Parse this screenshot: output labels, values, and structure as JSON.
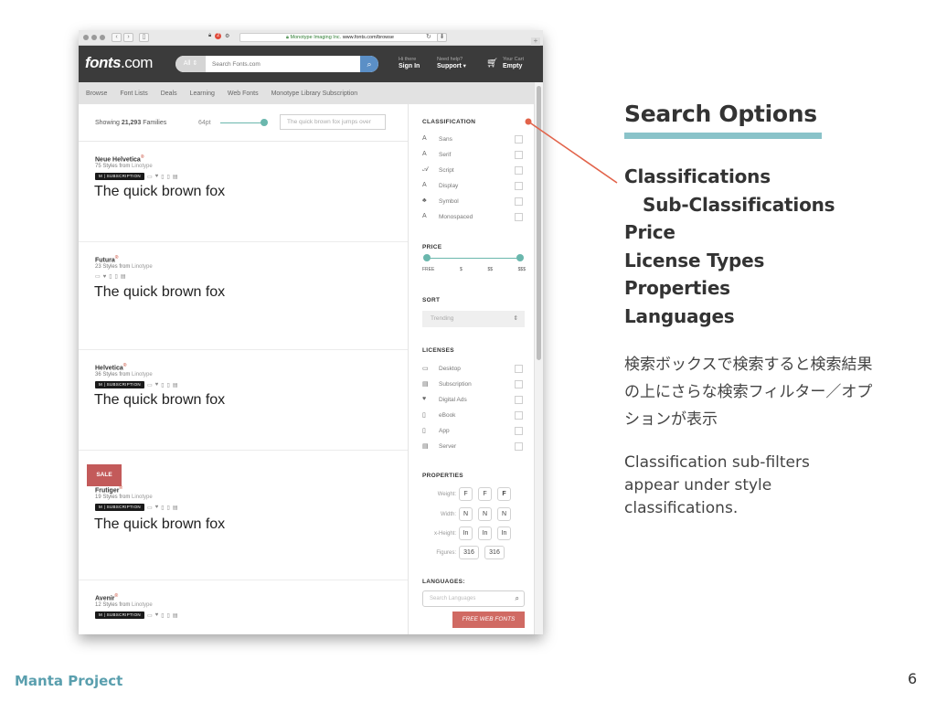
{
  "browser": {
    "url_org": "Monotype Imaging Inc.",
    "url_domain": "www.fonts.com/browse",
    "ext_badge": "2"
  },
  "site": {
    "logo_bold": "fonts",
    "logo_rest": ".com",
    "search_scope": "All",
    "search_placeholder": "Search Fonts.com",
    "hi_label": "Hi there",
    "signin": "Sign In",
    "help_label": "Need help?",
    "support": "Support",
    "cart_label": "Your Cart",
    "cart_status": "Empty"
  },
  "subnav": [
    "Browse",
    "Font Lists",
    "Deals",
    "Learning",
    "Web Fonts",
    "Monotype Library Subscription"
  ],
  "results_bar": {
    "showing_prefix": "Showing",
    "count": "21,293",
    "showing_suffix": "Families",
    "size": "64pt",
    "sample_placeholder": "The quick brown fox jumps over"
  },
  "fonts": [
    {
      "name": "Neue Helvetica",
      "styles": "75 Styles from",
      "foundry": "Linotype",
      "sample": "The quick brown fox",
      "subscription": true,
      "sale": false
    },
    {
      "name": "Futura",
      "styles": "23 Styles from",
      "foundry": "Linotype",
      "sample": "The quick brown fox",
      "subscription": false,
      "sale": false
    },
    {
      "name": "Helvetica",
      "styles": "36 Styles from",
      "foundry": "Linotype",
      "sample": "The quick brown fox",
      "subscription": true,
      "sale": false
    },
    {
      "name": "Frutiger",
      "styles": "19 Styles from",
      "foundry": "Linotype",
      "sample": "The quick brown fox",
      "subscription": true,
      "sale": true
    },
    {
      "name": "Avenir",
      "styles": "12 Styles from",
      "foundry": "Linotype",
      "sample": "The quick brown fox",
      "subscription": true,
      "sale": false
    }
  ],
  "subscription_label": "SUBSCRIPTION",
  "sale_label": "SALE",
  "filters": {
    "classification_title": "CLASSIFICATION",
    "classifications": [
      "Sans",
      "Serif",
      "Script",
      "Display",
      "Symbol",
      "Monospaced"
    ],
    "price_title": "PRICE",
    "price_labels": [
      "FREE",
      "$",
      "$$",
      "$$$"
    ],
    "sort_title": "SORT",
    "sort_value": "Trending",
    "licenses_title": "LICENSES",
    "licenses": [
      "Desktop",
      "Subscription",
      "Digital Ads",
      "eBook",
      "App",
      "Server"
    ],
    "properties_title": "PROPERTIES",
    "properties": [
      {
        "label": "Weight:",
        "options": [
          "F",
          "F",
          "F"
        ]
      },
      {
        "label": "Width:",
        "options": [
          "N",
          "N",
          "N"
        ]
      },
      {
        "label": "x-Height:",
        "options": [
          "In",
          "In",
          "In"
        ]
      },
      {
        "label": "Figures:",
        "options": [
          "316",
          "316"
        ]
      }
    ],
    "languages_title": "LANGUAGES:",
    "languages_placeholder": "Search Languages",
    "free_web_fonts": "FREE WEB FONTS"
  },
  "slide": {
    "heading": "Search Options",
    "options": [
      "Classifications",
      "Sub-Classifications",
      "Price",
      "License Types",
      "Properties",
      "Languages"
    ],
    "jp_text": "検索ボックスで検索すると検索結果の上にさらな検索フィルター／オプションが表示",
    "en_text": "Classification sub-filters appear under style classifications.",
    "footer_left": "Manta Project",
    "page_number": "6"
  },
  "colors": {
    "accent_teal": "#8ac3c9",
    "footer_blue": "#5a9fae",
    "callout_red": "#e2634a",
    "sale_red": "#c35a5a"
  }
}
